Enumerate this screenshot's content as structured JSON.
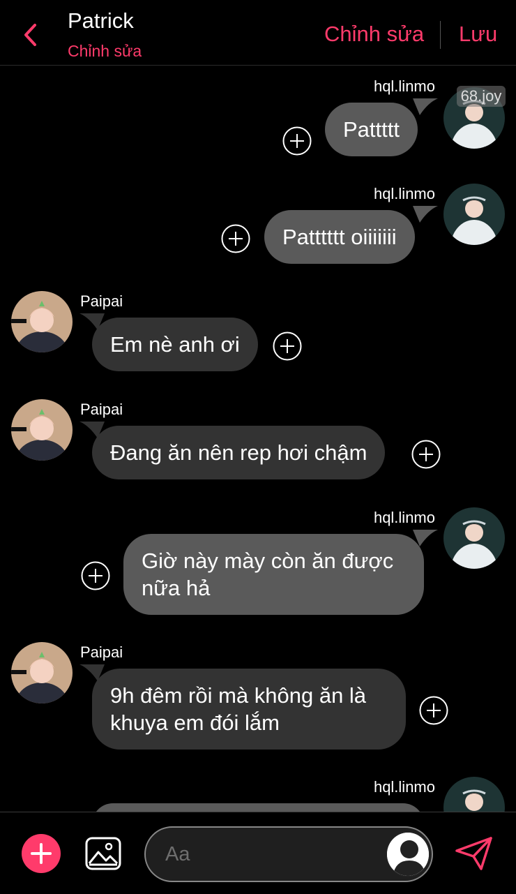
{
  "header": {
    "title": "Patrick",
    "subtitle": "Chỉnh sửa",
    "edit_label": "Chỉnh sửa",
    "save_label": "Lưu"
  },
  "chat": {
    "watermark": "68.joy",
    "messages": [
      {
        "side": "right",
        "sender": "hql.linmo",
        "text": "Pattttt"
      },
      {
        "side": "right",
        "sender": "hql.linmo",
        "text": "Patttttt oiiiiiii"
      },
      {
        "side": "left",
        "sender": "Paipai",
        "text": "Em nè anh ơi"
      },
      {
        "side": "left",
        "sender": "Paipai",
        "text": "Đang ăn nên rep hơi chậm"
      },
      {
        "side": "right",
        "sender": "hql.linmo",
        "text": "Giờ này mày còn ăn được\nnữa hả"
      },
      {
        "side": "left",
        "sender": "Paipai",
        "text": "9h đêm rồi mà không ăn là\nkhuya em đói lắm"
      },
      {
        "side": "right",
        "sender": "hql.linmo",
        "text": ""
      }
    ]
  },
  "composer": {
    "placeholder": "Aa"
  },
  "colors": {
    "accent": "#ff3b6b",
    "bubble_right": "#5a5a5a",
    "bubble_left": "#333333",
    "background": "#000000"
  },
  "icons": {
    "back": "chevron-left-icon",
    "add": "plus-icon",
    "gallery": "image-icon",
    "send": "paper-plane-icon",
    "react": "plus-circle-icon"
  }
}
